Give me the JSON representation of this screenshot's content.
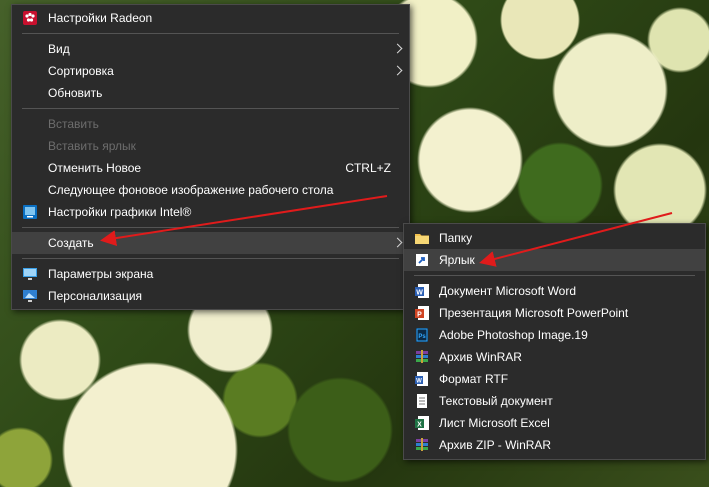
{
  "main_menu": {
    "items": [
      {
        "label": "Настройки Radeon",
        "icon": "radeon-icon"
      },
      {
        "label": "Вид"
      },
      {
        "label": "Сортировка"
      },
      {
        "label": "Обновить"
      },
      {
        "label": "Вставить"
      },
      {
        "label": "Вставить ярлык"
      },
      {
        "label": "Отменить Новое",
        "shortcut": "CTRL+Z"
      },
      {
        "label": "Следующее фоновое изображение рабочего стола"
      },
      {
        "label": "Настройки графики Intel®",
        "icon": "intel-graphics-icon"
      },
      {
        "label": "Создать"
      },
      {
        "label": "Параметры экрана",
        "icon": "display-settings-icon"
      },
      {
        "label": "Персонализация",
        "icon": "personalization-icon"
      }
    ]
  },
  "sub_menu": {
    "items": [
      {
        "label": "Папку",
        "icon": "folder-icon"
      },
      {
        "label": "Ярлык",
        "icon": "shortcut-icon"
      },
      {
        "label": "Документ Microsoft Word",
        "icon": "word-icon"
      },
      {
        "label": "Презентация Microsoft PowerPoint",
        "icon": "powerpoint-icon"
      },
      {
        "label": "Adobe Photoshop Image.19",
        "icon": "photoshop-icon"
      },
      {
        "label": "Архив WinRAR",
        "icon": "winrar-icon"
      },
      {
        "label": "Формат RTF",
        "icon": "rtf-icon"
      },
      {
        "label": "Текстовый документ",
        "icon": "text-document-icon"
      },
      {
        "label": "Лист Microsoft Excel",
        "icon": "excel-icon"
      },
      {
        "label": "Архив ZIP - WinRAR",
        "icon": "winrar-zip-icon"
      }
    ]
  },
  "colors": {
    "menu_bg": "#2b2b2b",
    "highlight": "#414141",
    "disabled_text": "#6d6d6d",
    "arrow": "#e01b1b"
  }
}
